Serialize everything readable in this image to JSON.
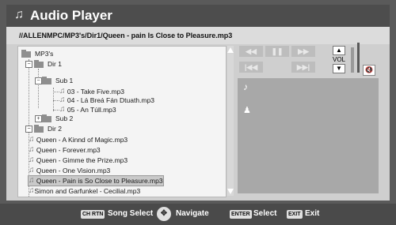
{
  "title": "Audio Player",
  "path": "//ALLENMPC/MP3's/Dir1/Queen - pain Is Close to Pleasure.mp3",
  "tree": {
    "root": "MP3's",
    "dir1": "Dir 1",
    "sub1": "Sub 1",
    "sub1_files": [
      "03 - Take Five.mp3",
      "04 - Lá Breá Fán Dtuath.mp3",
      "05 - An Túll.mp3"
    ],
    "sub2": "Sub 2",
    "dir2": "Dir 2",
    "dir2_files": [
      "Queen - A Kinnd of Magic.mp3",
      "Queen - Forever.mp3",
      "Queen - Gimme the Prize.mp3",
      "Queen - One Vision.mp3",
      "Queen - Pain is So Close to Pleasure.mp3",
      "Simon and Garfunkel - Cecilial.mp3"
    ],
    "selected_index": 4
  },
  "controls": {
    "rewind": "◀◀",
    "pause": "❚❚",
    "ffwd": "▶▶",
    "prev": "|◀◀",
    "next": "▶▶|",
    "vol_label": "VOL",
    "vol_up": "▲",
    "vol_down": "▼",
    "mute": "🔇"
  },
  "info": {
    "note_icon": "♪",
    "person_icon": "♟"
  },
  "footer": {
    "key1": "CH RTN",
    "label1": "Song Select",
    "nav_icon": "✥",
    "label2": "Navigate",
    "key3": "ENTER",
    "label3": "Select",
    "key4": "EXIT",
    "label4": "Exit"
  }
}
